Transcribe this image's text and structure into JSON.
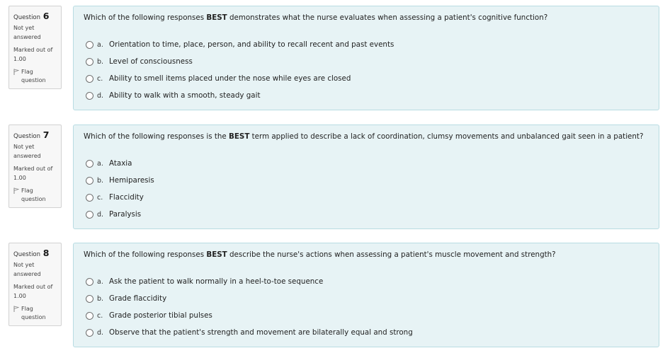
{
  "questions": [
    {
      "label": "Question",
      "number": "6",
      "state": "Not yet answered",
      "grade": "Marked out of 1.00",
      "flag_label": "Flag question",
      "text_before": "Which of the following responses ",
      "text_bold": "BEST",
      "text_after": " demonstrates what the nurse evaluates when assessing a patient's cognitive function?",
      "answers": [
        {
          "letter": "a.",
          "text": "Orientation to time, place, person, and ability to recall recent and past events"
        },
        {
          "letter": "b.",
          "text": "Level of consciousness"
        },
        {
          "letter": "c.",
          "text": "Ability to smell items placed under the nose while eyes are closed"
        },
        {
          "letter": "d.",
          "text": "Ability to walk with a smooth, steady gait"
        }
      ]
    },
    {
      "label": "Question",
      "number": "7",
      "state": "Not yet answered",
      "grade": "Marked out of 1.00",
      "flag_label": "Flag question",
      "text_before": "Which of the following responses is the ",
      "text_bold": "BEST",
      "text_after": " term applied to describe a lack of coordination, clumsy movements and unbalanced gait seen in a patient?",
      "answers": [
        {
          "letter": "a.",
          "text": "Ataxia"
        },
        {
          "letter": "b.",
          "text": "Hemiparesis"
        },
        {
          "letter": "c.",
          "text": "Flaccidity"
        },
        {
          "letter": "d.",
          "text": "Paralysis"
        }
      ]
    },
    {
      "label": "Question",
      "number": "8",
      "state": "Not yet answered",
      "grade": "Marked out of 1.00",
      "flag_label": "Flag question",
      "text_before": "Which of the following responses ",
      "text_bold": "BEST",
      "text_after": " describe the nurse's actions when assessing a patient's muscle movement and strength?",
      "answers": [
        {
          "letter": "a.",
          "text": "Ask the patient to walk normally in a heel-to-toe sequence"
        },
        {
          "letter": "b.",
          "text": "Grade flaccidity"
        },
        {
          "letter": "c.",
          "text": "Grade posterior tibial pulses"
        },
        {
          "letter": "d.",
          "text": "Observe that the patient's strength and movement are bilaterally equal and strong"
        }
      ]
    }
  ],
  "icons": {
    "flag": "flag-icon",
    "radio": "radio-unselected"
  },
  "colors": {
    "content_bg": "#e7f3f5",
    "content_border": "#b8dce2",
    "info_bg": "#f7f7f7"
  }
}
